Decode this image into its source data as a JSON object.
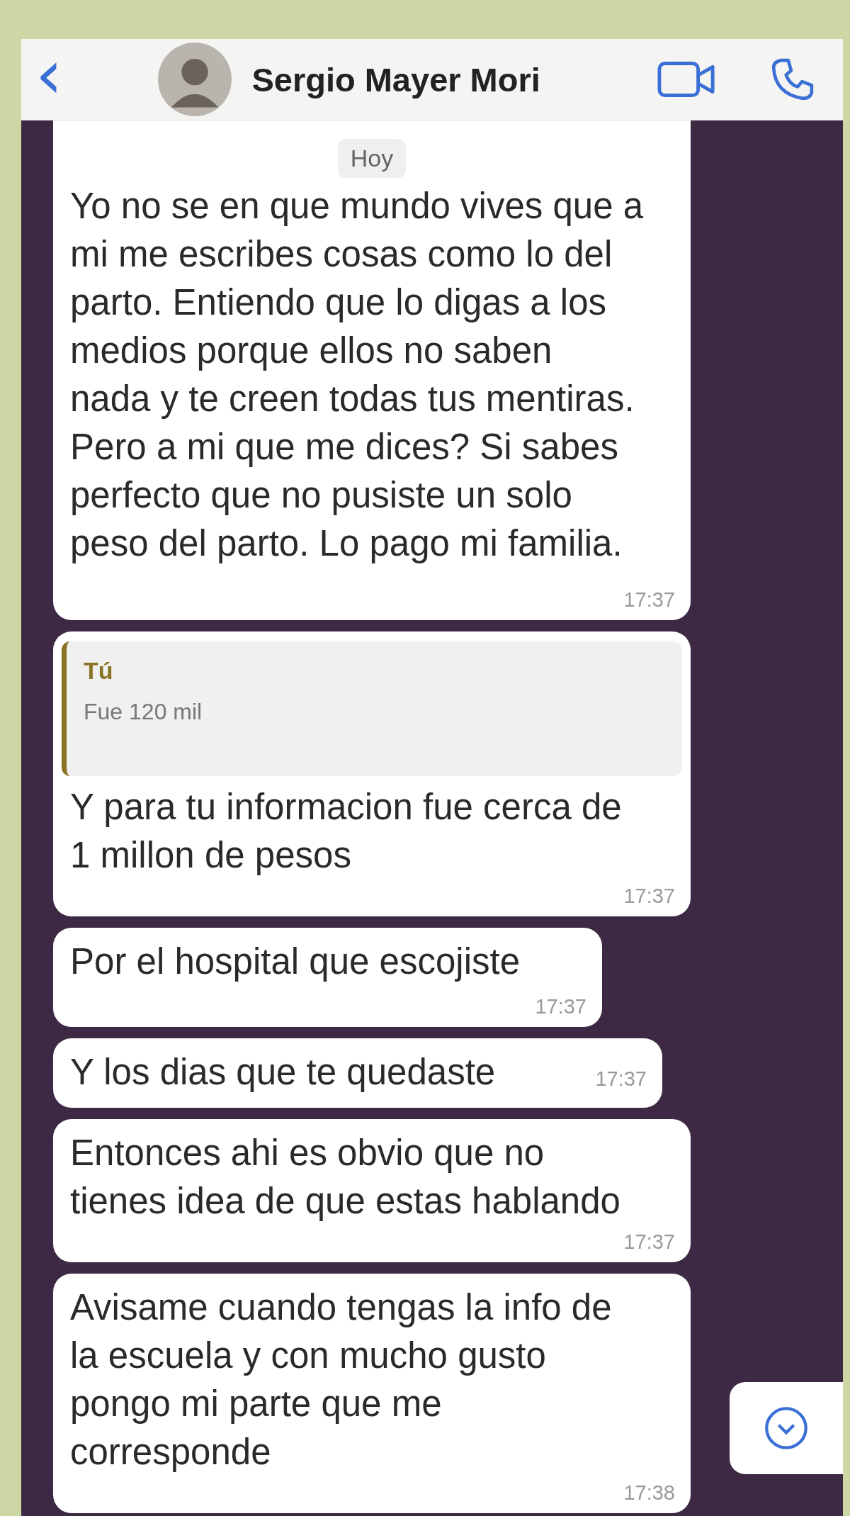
{
  "header": {
    "back_icon": "‹",
    "contact_name": "Sergio Mayer Mori"
  },
  "day_separator": "Hoy",
  "messages": [
    {
      "text": "Yo no se en que mundo vives que a\nmi me escribes cosas como lo del\nparto. Entiendo que lo digas a los\nmedios porque ellos no saben\nnada y te creen todas tus mentiras.\nPero a mi que me dices? Si sabes\nperfecto que no pusiste un solo\npeso del parto. Lo pago mi familia.",
      "time": "17:37"
    },
    {
      "quote": {
        "author": "Tú",
        "text": "Fue 120 mil"
      },
      "text": "Y para tu informacion fue cerca de\n1 millon de pesos",
      "time": "17:37"
    },
    {
      "text": "Por el hospital que escojiste",
      "time": "17:37"
    },
    {
      "text": "Y los dias que te quedaste",
      "time": "17:37"
    },
    {
      "text": "Entonces ahi es obvio que no\ntienes idea de que estas hablando",
      "time": "17:37"
    },
    {
      "text": "Avisame cuando tengas la info de\nla escuela y con mucho gusto\npongo mi parte que me\ncorresponde",
      "time": "17:38"
    }
  ]
}
